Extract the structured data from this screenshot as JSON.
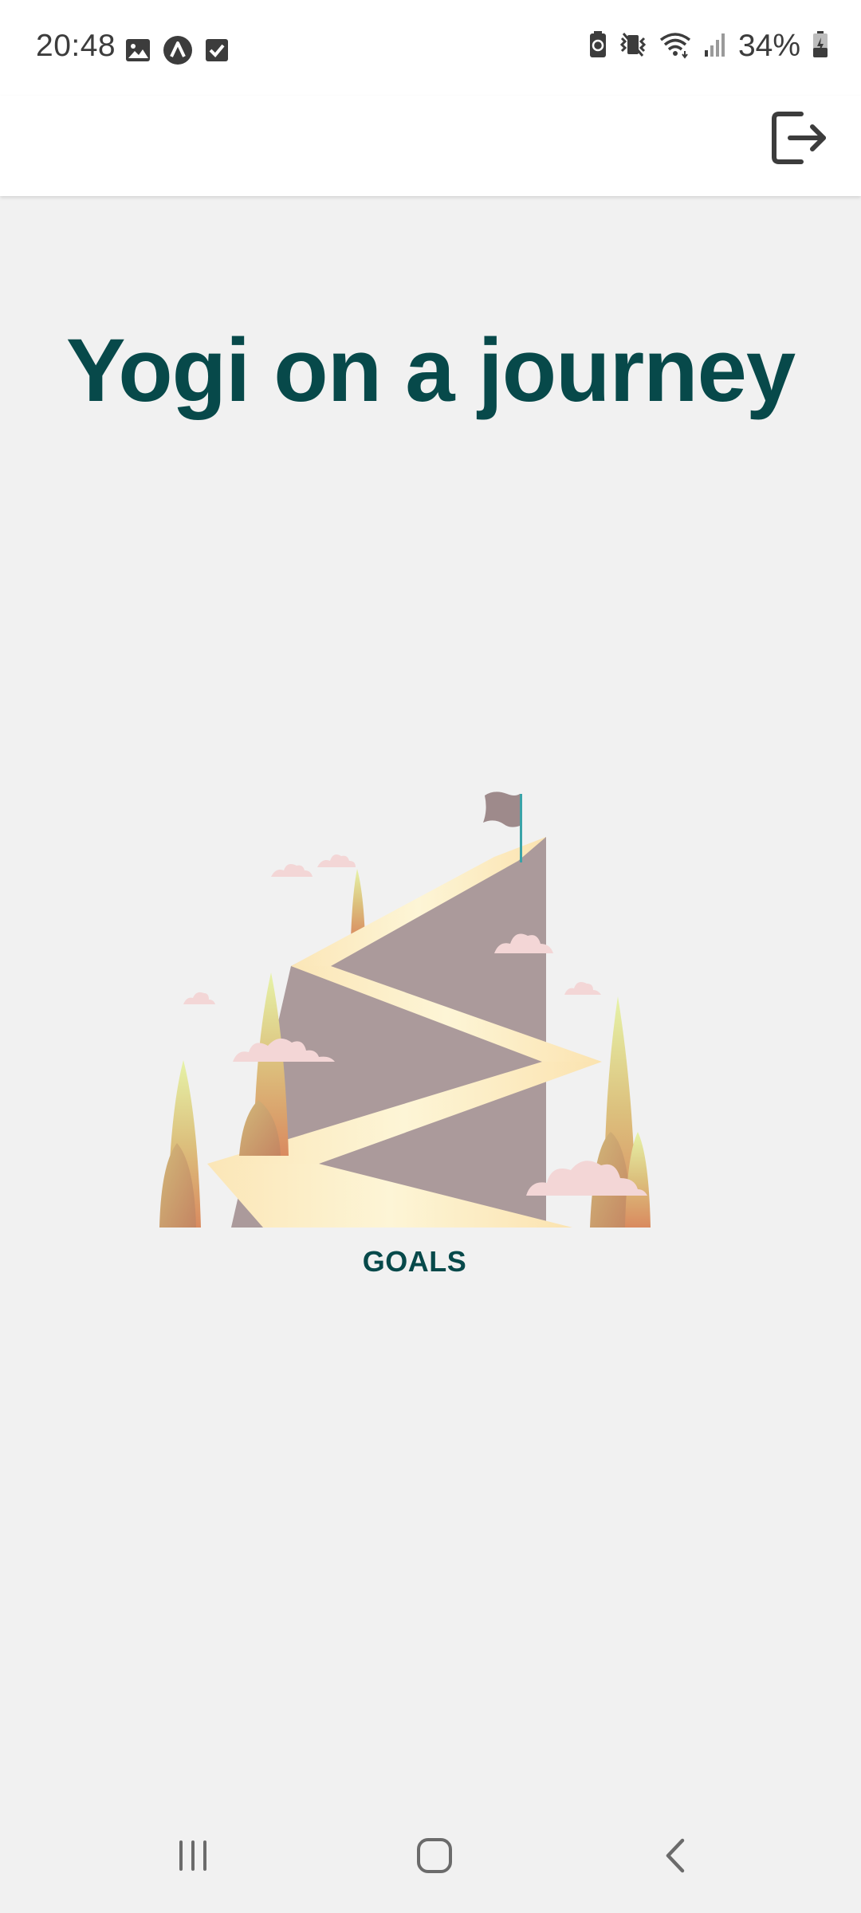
{
  "status_bar": {
    "time": "20:48",
    "battery_percent": "34%",
    "left_icons": [
      "gallery-icon",
      "app-notification-icon",
      "checkbox-icon"
    ],
    "right_icons": [
      "battery-saver-icon",
      "vibrate-icon",
      "wifi-icon",
      "signal-icon",
      "battery-charging-icon"
    ]
  },
  "app_bar": {
    "logout_icon": "logout-icon"
  },
  "main": {
    "title": "Yogi on a journey",
    "goals_card": {
      "label": "GOALS",
      "illustration": "mountain-path-flag-illustration"
    }
  },
  "navigation_bar": {
    "buttons": [
      "recent-apps-icon",
      "home-icon",
      "back-icon"
    ]
  },
  "colors": {
    "title": "#07494a",
    "background": "#f1f1f1",
    "app_bar": "#ffffff",
    "icon": "#3c3c3c"
  }
}
